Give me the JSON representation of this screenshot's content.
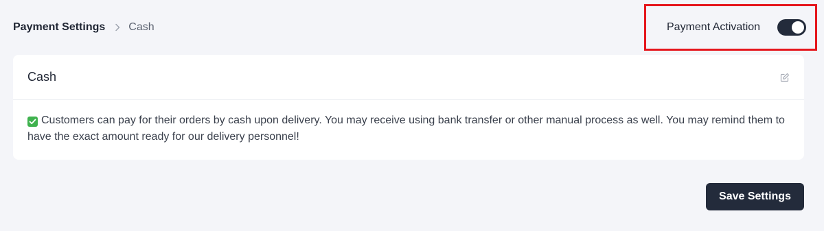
{
  "breadcrumb": {
    "root": "Payment Settings",
    "current": "Cash"
  },
  "activation": {
    "label": "Payment Activation",
    "enabled": true
  },
  "card": {
    "title": "Cash",
    "edit_icon": "edit-icon",
    "check_icon": "white-check-mark-icon",
    "description": "Customers can pay for their orders by cash upon delivery. You may receive using bank transfer or other manual process as well. You may remind them to have the exact amount ready for our delivery personnel!"
  },
  "actions": {
    "save_label": "Save Settings"
  },
  "colors": {
    "background": "#f4f5f9",
    "primary_dark": "#232b3b",
    "highlight_border": "#e5161c",
    "check_green": "#3fb24e"
  }
}
